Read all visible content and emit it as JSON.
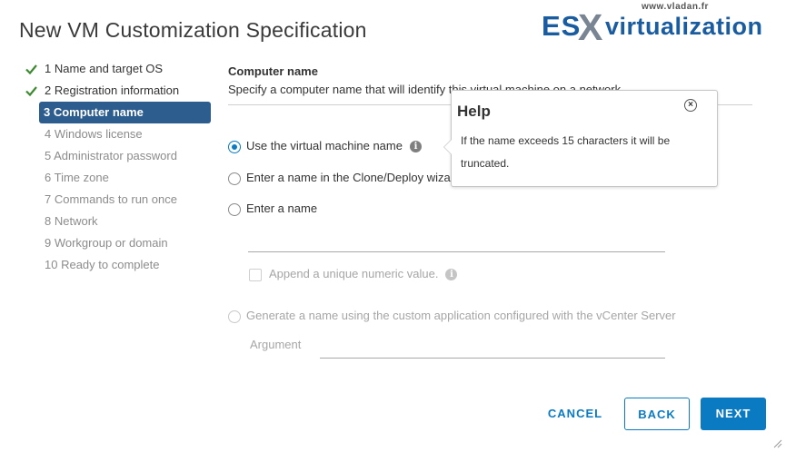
{
  "dialog": {
    "title": "New VM Customization Specification"
  },
  "logo": {
    "url": "www.vladan.fr",
    "es": "ES",
    "x": "X",
    "rest": "virtualization"
  },
  "steps": [
    {
      "label": "1 Name and target OS",
      "state": "done"
    },
    {
      "label": "2 Registration information",
      "state": "done"
    },
    {
      "label": "3 Computer name",
      "state": "active"
    },
    {
      "label": "4 Windows license",
      "state": "todo"
    },
    {
      "label": "5 Administrator password",
      "state": "todo"
    },
    {
      "label": "6 Time zone",
      "state": "todo"
    },
    {
      "label": "7 Commands to run once",
      "state": "todo"
    },
    {
      "label": "8 Network",
      "state": "todo"
    },
    {
      "label": "9 Workgroup or domain",
      "state": "todo"
    },
    {
      "label": "10 Ready to complete",
      "state": "todo"
    }
  ],
  "section": {
    "title": "Computer name",
    "description": "Specify a computer name that will identify this virtual machine on a network."
  },
  "options": {
    "use_vm_name": "Use the virtual machine name",
    "enter_in_wizard": "Enter a name in the Clone/Deploy wizard",
    "enter_name": "Enter a name",
    "append_numeric": "Append a unique numeric value.",
    "generate_custom": "Generate a name using the custom application configured with the vCenter Server",
    "argument_label": "Argument",
    "selected": "use_vm_name"
  },
  "help": {
    "title": "Help",
    "body": "If the name exceeds 15 characters it will be truncated."
  },
  "buttons": {
    "cancel": "CANCEL",
    "back": "BACK",
    "next": "NEXT"
  },
  "colors": {
    "accent": "#0a7bc2",
    "active_step": "#2d5d8f",
    "check": "#3c8a2f"
  },
  "icons": {
    "done_step": "check-icon",
    "info": "info-icon",
    "close": "close-icon"
  }
}
